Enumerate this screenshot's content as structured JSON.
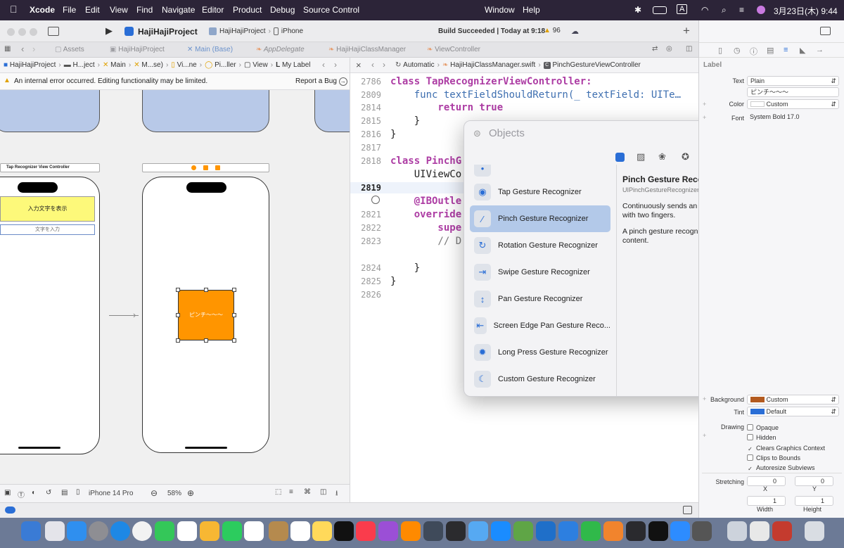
{
  "menubar": {
    "app": "Xcode",
    "items": [
      "File",
      "Edit",
      "View",
      "Find",
      "Navigate",
      "Editor",
      "Product",
      "Debug",
      "Source Control",
      "Window",
      "Help"
    ],
    "clock": "3月23日(木)  9:44",
    "input_mode": "A"
  },
  "toolbar": {
    "project": "HajiHajiProject",
    "scheme": "HajiHajiProject",
    "device": "iPhone",
    "status": "Build Succeeded | Today at 9:18",
    "warnings": "96",
    "add": "+"
  },
  "tabs": [
    "Assets",
    "HajiHajiProject",
    "Main (Base)",
    "AppDelegate",
    "HajiHajiClassManager",
    "ViewController"
  ],
  "jumpbar": [
    "HajiHajiProject",
    "H...ject",
    "Main",
    "M...se)",
    "Vi...ne",
    "Pi...ller",
    "View",
    "My Label"
  ],
  "error": {
    "text": "An internal error occurred. Editing functionality may be limited.",
    "action": "Report a Bug"
  },
  "canvas": {
    "scene_title": "Tap Recognizer View Controller",
    "yellow_label": "入力文字を表示",
    "textfield_placeholder": "文字を入力",
    "orange_label": "ピンチ～～～",
    "device_label": "iPhone 14 Pro",
    "zoom": "58%"
  },
  "editor": {
    "breadcrumb": [
      "Automatic",
      "HajiHajiClassManager.swift",
      "PinchGestureViewController"
    ],
    "lines": [
      {
        "n": "2786",
        "code": "class TapRecognizerViewController:"
      },
      {
        "n": "2809",
        "code": "    func textFieldShouldReturn(_ textField: UITe…"
      },
      {
        "n": "2814",
        "code": "        return true"
      },
      {
        "n": "2815",
        "code": "    }"
      },
      {
        "n": "2816",
        "code": "}"
      },
      {
        "n": "2817",
        "code": ""
      },
      {
        "n": "2818",
        "code": "class PinchG"
      },
      {
        "n": "",
        "code": "    UIViewCo"
      },
      {
        "n": "2819",
        "code": ""
      },
      {
        "n": "",
        "code": "    @IBOutle"
      },
      {
        "n": "2821",
        "code": "    override"
      },
      {
        "n": "2822",
        "code": "        supe"
      },
      {
        "n": "2823",
        "code": "        // D"
      },
      {
        "n": "",
        "code": ""
      },
      {
        "n": "2824",
        "code": "    }"
      },
      {
        "n": "2825",
        "code": "}"
      },
      {
        "n": "2826",
        "code": ""
      }
    ]
  },
  "objects": {
    "search_placeholder": "Objects",
    "items": [
      "Tap Gesture Recognizer",
      "Pinch Gesture Recognizer",
      "Rotation Gesture Recognizer",
      "Swipe Gesture Recognizer",
      "Pan Gesture Recognizer",
      "Screen Edge Pan Gesture Reco...",
      "Long Press Gesture Recognizer",
      "Custom Gesture Recognizer"
    ],
    "selected_index": 1,
    "detail": {
      "title": "Pinch Gesture Recognizer",
      "subtitle": "UIPinchGestureRecognizer: Recognizes pinch gestures",
      "p1": "Continuously sends an action message while the user pinches with two fingers.",
      "p2": "A pinch gesture recognizer is often used to zoom or scale content."
    }
  },
  "inspector": {
    "section": "Label",
    "text_label": "Text",
    "text_value": "Plain",
    "text_content": "ピンチ～～～",
    "color_label": "Color",
    "color_value": "Custom",
    "font_label": "Font",
    "font_value": "System Bold 17.0",
    "background_label": "Background",
    "background_value": "Custom",
    "tint_label": "Tint",
    "tint_value": "Default",
    "drawing_label": "Drawing",
    "checks": [
      {
        "label": "Opaque",
        "checked": false
      },
      {
        "label": "Hidden",
        "checked": false
      },
      {
        "label": "Clears Graphics Context",
        "checked": true
      },
      {
        "label": "Clips to Bounds",
        "checked": false
      },
      {
        "label": "Autoresize Subviews",
        "checked": true
      }
    ],
    "stretching_label": "Stretching",
    "x_label": "X",
    "y_label": "Y",
    "width_label": "Width",
    "height_label": "Height",
    "x": "0",
    "y": "0",
    "w": "1",
    "h": "1"
  },
  "colors": {
    "orange": "#ff9500",
    "yellow": "#fdf97a",
    "accent": "#2a6ed6"
  }
}
